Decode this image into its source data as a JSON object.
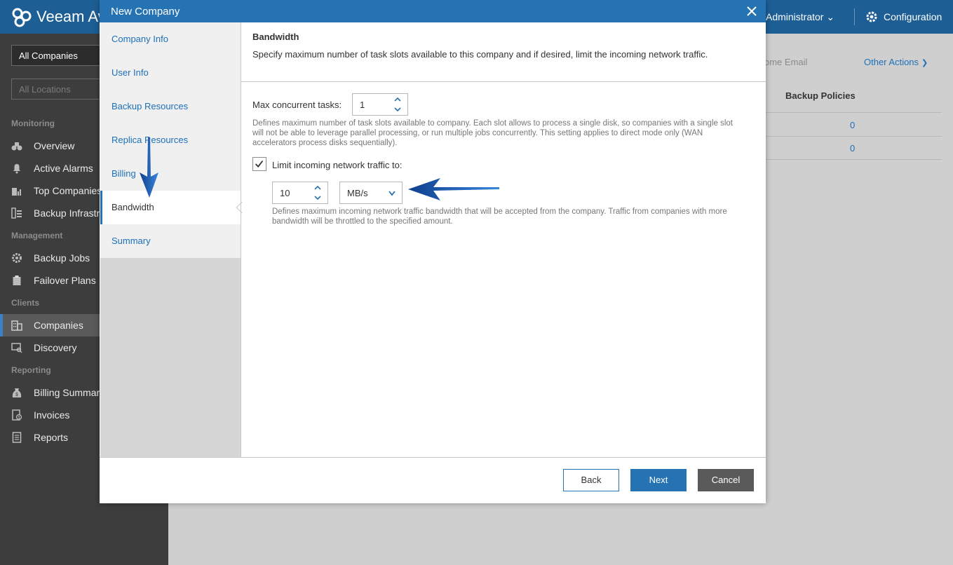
{
  "header": {
    "app_title": "Veeam Av",
    "user": "Administrator",
    "config_label": "Configuration"
  },
  "sidebar": {
    "company_filter": "All Companies",
    "location_filter": "All Locations",
    "sections": {
      "monitoring": "Monitoring",
      "management": "Management",
      "clients": "Clients",
      "reporting": "Reporting"
    },
    "items": {
      "overview": "Overview",
      "active_alarms": "Active Alarms",
      "top_companies": "Top Companies",
      "backup_infrastructure": "Backup Infrastr",
      "backup_jobs": "Backup Jobs",
      "failover_plans": "Failover Plans",
      "companies": "Companies",
      "discovery": "Discovery",
      "billing_summary": "Billing Summary",
      "invoices": "Invoices",
      "reports": "Reports"
    }
  },
  "background_page": {
    "welcome_email": "ome Email",
    "other_actions": "Other Actions",
    "column_header": "Backup Policies",
    "rows": [
      "0",
      "0"
    ]
  },
  "dialog": {
    "title": "New Company",
    "steps": {
      "company_info": "Company Info",
      "user_info": "User Info",
      "backup_resources": "Backup Resources",
      "replica_resources": "Replica Resources",
      "billing": "Billing",
      "bandwidth": "Bandwidth",
      "summary": "Summary"
    },
    "active_step": "Bandwidth",
    "section_title": "Bandwidth",
    "section_desc": "Specify maximum number of task slots available to this company and if desired, limit the incoming network traffic.",
    "max_tasks_label": "Max concurrent tasks:",
    "max_tasks_value": "1",
    "max_tasks_hint": "Defines maximum number of task slots available to company. Each slot allows to process a single disk, so companies with a single slot will not be able to leverage parallel processing, or run multiple jobs concurrently. This setting applies to direct mode only (WAN accelerators process disks sequentially).",
    "limit_checked": true,
    "limit_label": "Limit incoming network traffic to:",
    "limit_value": "10",
    "limit_unit": "MB/s",
    "limit_hint": "Defines maximum incoming network traffic bandwidth that will be accepted from the company. Traffic from companies with more bandwidth will be throttled to the specified amount.",
    "buttons": {
      "back": "Back",
      "next": "Next",
      "cancel": "Cancel"
    }
  },
  "colors": {
    "header_blue": "#1d5e95",
    "dialog_blue": "#2673b4",
    "link_blue": "#1d6fb8",
    "sidebar_dark": "#3d3d3d",
    "annotation_arrow": "#1f5fb5"
  }
}
